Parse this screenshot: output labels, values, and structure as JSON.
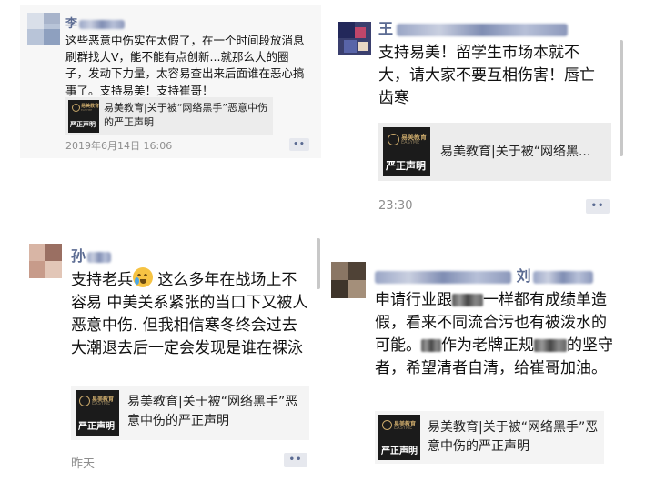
{
  "cards": [
    {
      "name": "李",
      "text": "这些恶意中伤实在太假了，在一个时间段放消息刷群找大V，能不能有点创新...就那么大的圈子，发动下力量，太容易查出来后面谁在恶心搞事了。支持易美！支持崔哥！",
      "share": {
        "stamp": "严正声明",
        "title": "易美教育|关于被“网络黑手”恶意中伤的严正声明"
      },
      "time": "2019年6月14日 16:06"
    },
    {
      "name": "王",
      "text": "支持易美！留学生市场本就不大，请大家不要互相伤害！唇亡齿寒",
      "share": {
        "stamp": "严正声明",
        "title": "易美教育|关于被“网络黑..."
      },
      "time": "23:30"
    },
    {
      "name": "孙",
      "text_a": "支持老兵",
      "text_b": " 这么多年在战场上不容易 中美关系紧张的当口下又被人恶意中伤. 但我相信寒冬终会过去 大潮退去后一定会发现是谁在裸泳",
      "share": {
        "stamp": "严正声明",
        "title": "易美教育|关于被“网络黑手”恶意中伤的严正声明"
      },
      "time": "昨天"
    },
    {
      "name": "刘",
      "text_a": "申请行业跟",
      "text_b": "一样都有成绩单造假，看来不同流合污也有被泼水的可能。",
      "text_c": "作为老牌正规",
      "text_d": "的坚守者，希望清者自清，给崔哥加油。",
      "share": {
        "stamp": "严正声明",
        "title": "易美教育|关于被“网络黑手”恶意中伤的严正声明"
      }
    }
  ],
  "logo": {
    "brand": "易美教育",
    "sub": "EASYME"
  },
  "more_label": "••",
  "icons": {
    "more": "more-dots-icon",
    "emoji": "crying-laughing-emoji-icon"
  }
}
